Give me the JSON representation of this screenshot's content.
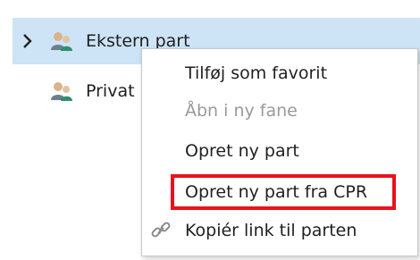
{
  "tree": {
    "items": [
      {
        "label": "Ekstern part",
        "icon": "people-icon",
        "expand_icon": "chevron-right-icon",
        "selected": true
      },
      {
        "label": "Privat part",
        "icon": "people-icon"
      }
    ]
  },
  "context_menu": {
    "items": [
      {
        "label": "Tilføj som favorit",
        "enabled": true
      },
      {
        "label": "Åbn i ny fane",
        "enabled": false
      },
      {
        "label": "Opret ny part",
        "enabled": true
      },
      {
        "label": "Opret ny part fra CPR",
        "enabled": true,
        "highlighted": true
      },
      {
        "label": "Kopiér link til parten",
        "enabled": true,
        "icon": "link-icon"
      }
    ]
  },
  "colors": {
    "selection": "#cce4f6",
    "highlight_border": "#e8131b",
    "disabled_text": "#9a9a9a"
  }
}
